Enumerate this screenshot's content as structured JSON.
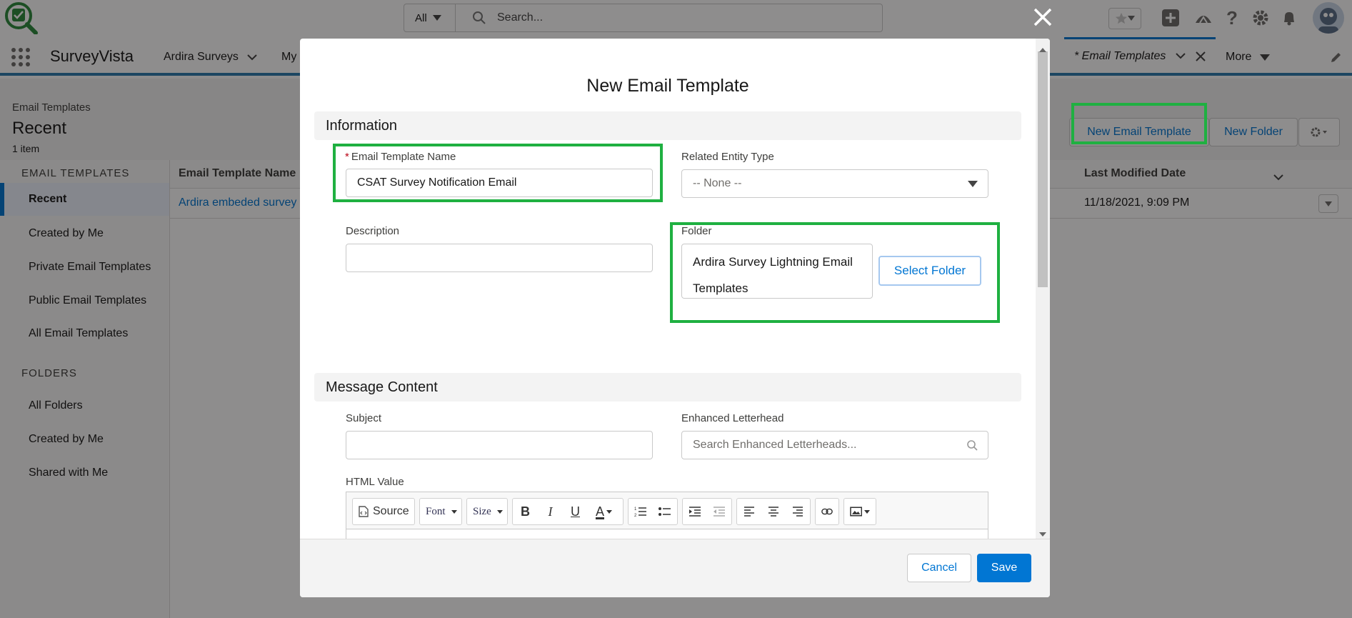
{
  "header": {
    "search_scope": "All",
    "search_placeholder": "Search..."
  },
  "nav": {
    "app_name": "SurveyVista",
    "items": [
      {
        "label": "Ardira Surveys"
      },
      {
        "label": "My"
      }
    ],
    "active_tab": "* Email Templates",
    "more_label": "More"
  },
  "page": {
    "breadcrumb": "Email Templates",
    "title": "Recent",
    "count": "1 item",
    "new_template_button": "New Email Template",
    "new_folder_button": "New Folder"
  },
  "sidebar": {
    "templates_heading": "EMAIL TEMPLATES",
    "template_items": [
      {
        "label": "Recent"
      },
      {
        "label": "Created by Me"
      },
      {
        "label": "Private Email Templates"
      },
      {
        "label": "Public Email Templates"
      },
      {
        "label": "All Email Templates"
      }
    ],
    "folders_heading": "FOLDERS",
    "folder_items": [
      {
        "label": "All Folders"
      },
      {
        "label": "Created by Me"
      },
      {
        "label": "Shared with Me"
      }
    ]
  },
  "table": {
    "col_name": "Email Template Name",
    "col_modified": "Last Modified Date",
    "rows": [
      {
        "name": "Ardira embeded survey",
        "modified": "11/18/2021, 9:09 PM"
      }
    ]
  },
  "modal": {
    "title": "New Email Template",
    "section_information": "Information",
    "section_message": "Message Content",
    "template_name_label": "Email Template Name",
    "template_name_value": "CSAT Survey Notification Email",
    "related_entity_label": "Related Entity Type",
    "related_entity_value": "-- None --",
    "description_label": "Description",
    "description_value": "",
    "folder_label": "Folder",
    "folder_value_line1": "Ardira Survey Lightning Email",
    "folder_value_line2": "Templates",
    "select_folder_button": "Select Folder",
    "subject_label": "Subject",
    "subject_value": "",
    "letterhead_label": "Enhanced Letterhead",
    "letterhead_placeholder": "Search Enhanced Letterheads...",
    "html_value_label": "HTML Value",
    "toolbar": {
      "source": "Source",
      "font": "Font",
      "size": "Size"
    },
    "cancel_button": "Cancel",
    "save_button": "Save"
  },
  "colors": {
    "brand_blue": "#0176d3",
    "highlight_green": "#1fb041",
    "required_red": "#ba0517"
  }
}
